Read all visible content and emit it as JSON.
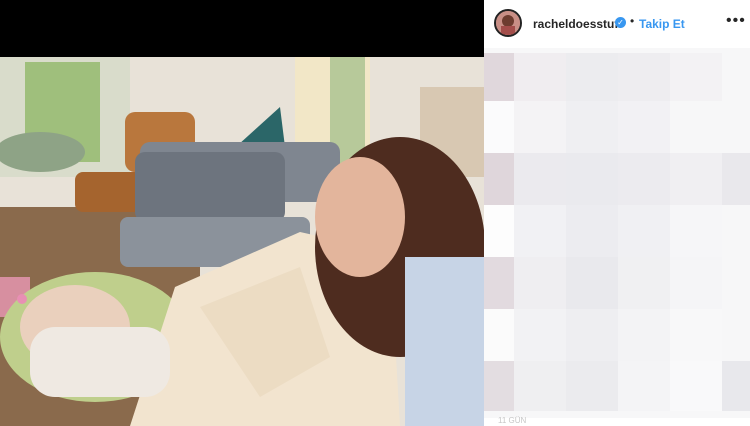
{
  "post": {
    "username": "racheldoesstuff",
    "follow_label": "Takip Et",
    "separator": "•",
    "more_label": "•••",
    "timestamp": "11 GÜN"
  },
  "colors": {
    "accent": "#3897f0",
    "background": "#ffffff",
    "photo_letterbox": "#000000"
  },
  "icons": {
    "verified": "check-badge-icon",
    "more": "more-options-icon"
  }
}
